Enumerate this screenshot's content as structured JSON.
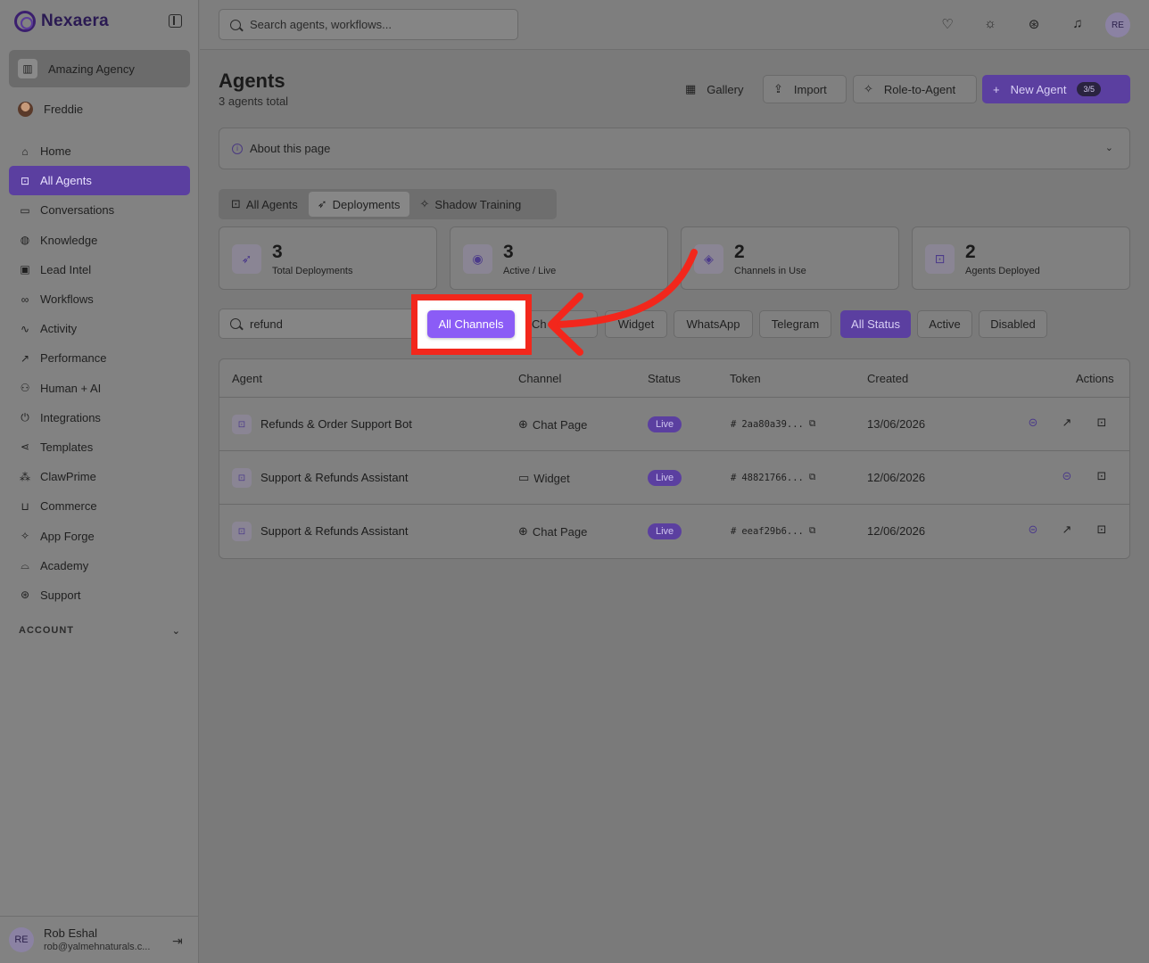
{
  "brand": {
    "name": "Nexaera"
  },
  "org": {
    "name": "Amazing Agency"
  },
  "user": {
    "name": "Freddie"
  },
  "nav": [
    {
      "label": "Home",
      "icon": "home-icon"
    },
    {
      "label": "All Agents",
      "icon": "bot-icon",
      "active": true
    },
    {
      "label": "Conversations",
      "icon": "message-icon"
    },
    {
      "label": "Knowledge",
      "icon": "brain-icon"
    },
    {
      "label": "Lead Intel",
      "icon": "contact-icon"
    },
    {
      "label": "Workflows",
      "icon": "workflow-icon"
    },
    {
      "label": "Activity",
      "icon": "activity-icon"
    },
    {
      "label": "Performance",
      "icon": "trend-icon"
    },
    {
      "label": "Human + AI",
      "icon": "people-icon"
    },
    {
      "label": "Integrations",
      "icon": "plug-icon"
    },
    {
      "label": "Templates",
      "icon": "share-icon"
    },
    {
      "label": "ClawPrime",
      "icon": "paw-icon"
    },
    {
      "label": "Commerce",
      "icon": "cart-icon"
    },
    {
      "label": "App Forge",
      "icon": "sparkle-icon"
    },
    {
      "label": "Academy",
      "icon": "graduation-icon"
    },
    {
      "label": "Support",
      "icon": "lifebuoy-icon"
    }
  ],
  "account_label": "ACCOUNT",
  "footer": {
    "initials": "RE",
    "name": "Rob Eshal",
    "email": "rob@yalmehnaturals.c..."
  },
  "topbar": {
    "search_placeholder": "Search agents, workflows...",
    "avatar": "RE"
  },
  "page": {
    "title": "Agents",
    "subtitle": "3 agents total"
  },
  "header_buttons": {
    "gallery": "Gallery",
    "import": "Import",
    "role_to_agent": "Role-to-Agent",
    "new_agent": "New Agent",
    "quota": "3/5"
  },
  "about": {
    "label": "About this page"
  },
  "tabs": [
    {
      "label": "All Agents",
      "icon": "bot-icon"
    },
    {
      "label": "Deployments",
      "icon": "rocket-icon",
      "active": true
    },
    {
      "label": "Shadow Training",
      "icon": "sparkle-icon"
    }
  ],
  "stats": [
    {
      "value": "3",
      "label": "Total Deployments",
      "icon": "rocket-icon"
    },
    {
      "value": "3",
      "label": "Active / Live",
      "icon": "broadcast-icon"
    },
    {
      "value": "2",
      "label": "Channels in Use",
      "icon": "layers-icon"
    },
    {
      "value": "2",
      "label": "Agents Deployed",
      "icon": "bot-icon"
    }
  ],
  "filters": {
    "search_value": "refund",
    "channels_all": "All Channels",
    "channel_partial": "Ch",
    "widget": "Widget",
    "whatsapp": "WhatsApp",
    "telegram": "Telegram",
    "status_all": "All Status",
    "active": "Active",
    "disabled": "Disabled"
  },
  "table": {
    "headers": {
      "agent": "Agent",
      "channel": "Channel",
      "status": "Status",
      "token": "Token",
      "created": "Created",
      "actions": "Actions"
    },
    "rows": [
      {
        "agent": "Refunds & Order Support Bot",
        "channel": "Chat Page",
        "channel_icon": "globe-icon",
        "status": "Live",
        "token": "2aa80a39...",
        "created": "13/06/2026"
      },
      {
        "agent": "Support & Refunds Assistant",
        "channel": "Widget",
        "channel_icon": "message-icon",
        "status": "Live",
        "token": "48821766...",
        "created": "12/06/2026"
      },
      {
        "agent": "Support & Refunds Assistant",
        "channel": "Chat Page",
        "channel_icon": "globe-icon",
        "status": "Live",
        "token": "eeaf29b6...",
        "created": "12/06/2026"
      }
    ]
  },
  "colors": {
    "accent": "#5b3fa0",
    "highlight_red": "#f2271c",
    "highlight_button": "#8b5cf6"
  }
}
